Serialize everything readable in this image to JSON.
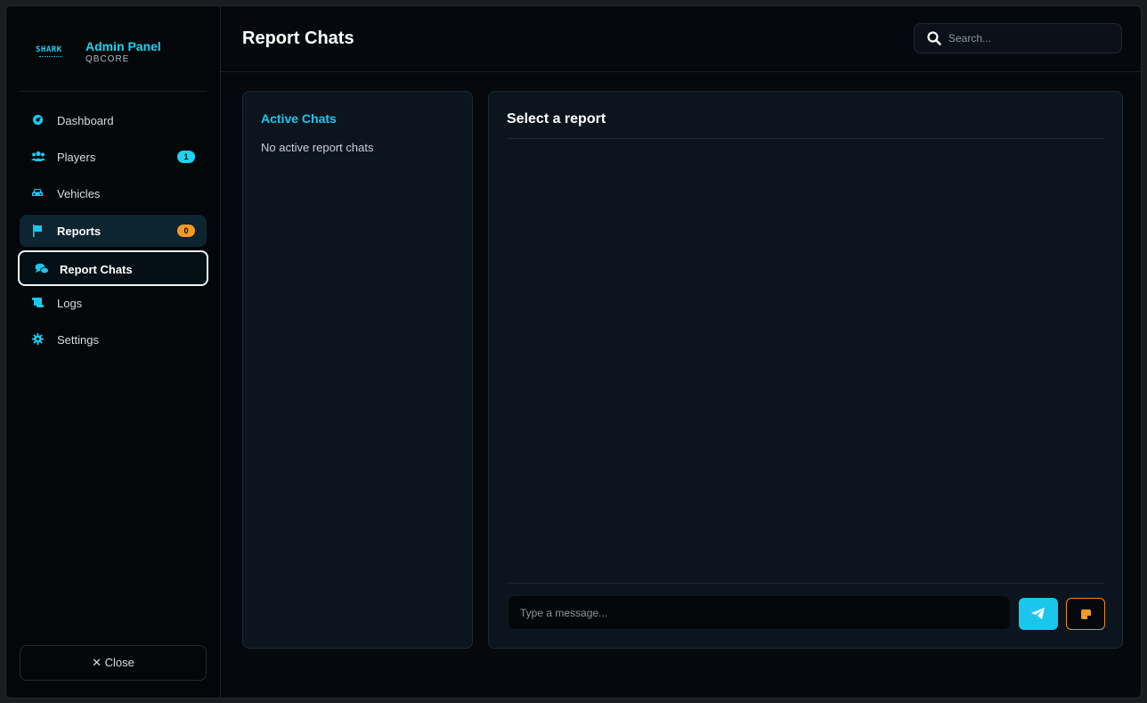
{
  "brand": {
    "logo_text": "SHARK",
    "title": "Admin Panel",
    "subtitle": "QBCORE"
  },
  "sidebar": {
    "items": [
      {
        "label": "Dashboard",
        "icon": "gauge-icon"
      },
      {
        "label": "Players",
        "icon": "users-icon",
        "badge": "1",
        "badge_color": "#19d4f2"
      },
      {
        "label": "Vehicles",
        "icon": "car-icon"
      },
      {
        "label": "Reports",
        "icon": "flag-icon",
        "badge": "0",
        "badge_color": "#f59a23"
      },
      {
        "label": "Report Chats",
        "icon": "comments-icon"
      },
      {
        "label": "Logs",
        "icon": "scroll-icon"
      },
      {
        "label": "Settings",
        "icon": "gear-icon"
      }
    ],
    "close_label": "✕ Close"
  },
  "header": {
    "title": "Report Chats",
    "search_placeholder": "Search..."
  },
  "chats": {
    "title": "Active Chats",
    "empty_text": "No active report chats"
  },
  "conversation": {
    "title": "Select a report",
    "message_placeholder": "Type a message..."
  },
  "colors": {
    "accent": "#19d4f2",
    "warning": "#f59a23",
    "background": "#05090d"
  }
}
